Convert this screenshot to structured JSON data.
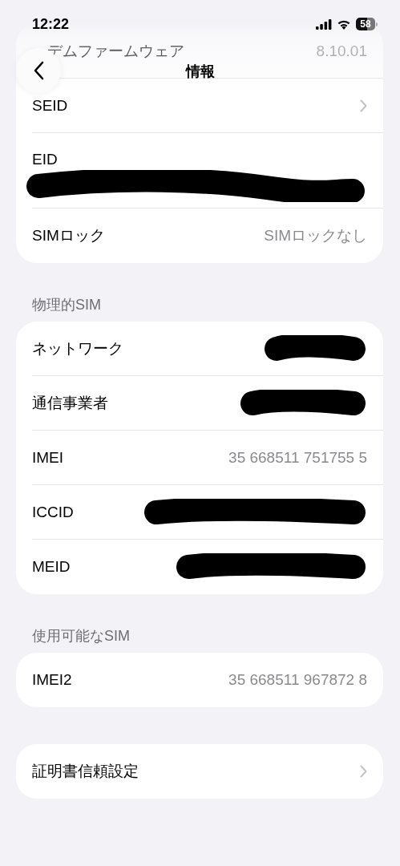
{
  "status_bar": {
    "time": "12:22",
    "battery": "58"
  },
  "nav": {
    "title": "情報"
  },
  "sections": [
    {
      "rows": [
        {
          "label": "デムファームウェア",
          "kind": "text",
          "value": "8.10.01"
        },
        {
          "label": "SEID",
          "kind": "chevron"
        },
        {
          "label": "EID",
          "kind": "redacted_below"
        },
        {
          "label": "SIMロック",
          "kind": "text",
          "value": "SIMロックなし"
        }
      ]
    },
    {
      "header": "物理的SIM",
      "rows": [
        {
          "label": "ネットワーク",
          "kind": "redacted"
        },
        {
          "label": "通信事業者",
          "kind": "redacted"
        },
        {
          "label": "IMEI",
          "kind": "text",
          "value": "35 668511 751755 5"
        },
        {
          "label": "ICCID",
          "kind": "redacted"
        },
        {
          "label": "MEID",
          "kind": "redacted"
        }
      ]
    },
    {
      "header": "使用可能なSIM",
      "rows": [
        {
          "label": "IMEI2",
          "kind": "text",
          "value": "35 668511 967872 8"
        }
      ]
    },
    {
      "rows": [
        {
          "label": "証明書信頼設定",
          "kind": "chevron"
        }
      ]
    }
  ]
}
